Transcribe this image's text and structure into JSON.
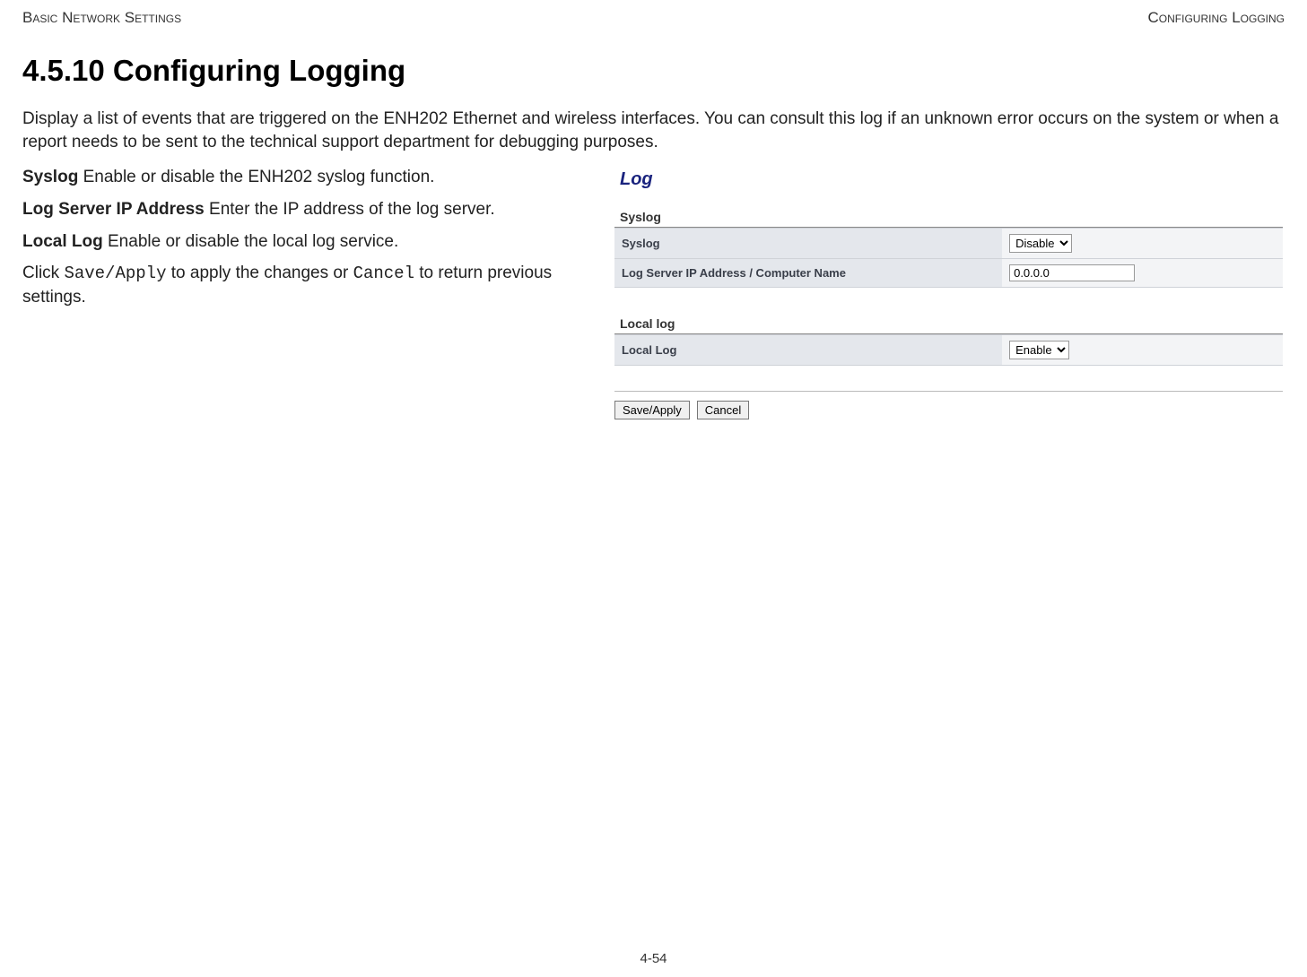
{
  "header": {
    "left": "Basic Network Settings",
    "right": "Configuring Logging"
  },
  "section": {
    "heading": "4.5.10 Configuring Logging",
    "intro": "Display a list of events that are triggered on the ENH202 Ethernet and wireless interfaces. You can consult this log if an unknown error occurs on the system or when a report needs to be sent to the technical support department for debugging purposes."
  },
  "definitions": {
    "syslog_term": "Syslog",
    "syslog_desc": "  Enable or disable the ENH202 syslog function.",
    "logserver_term": "Log Server IP Address",
    "logserver_desc": "  Enter the IP address of the log server.",
    "locallog_term": "Local Log",
    "locallog_desc": "  Enable or disable the local log service.",
    "click_prefix": "Click ",
    "save_apply_code": "Save/Apply",
    "click_mid": " to apply the changes or ",
    "cancel_code": "Cancel",
    "click_suffix": " to return previous settings."
  },
  "ui": {
    "title": "Log",
    "syslog_section": "Syslog",
    "syslog_row_label": "Syslog",
    "syslog_select_value": "Disable",
    "logserver_row_label": "Log Server IP Address / Computer Name",
    "logserver_input_value": "0.0.0.0",
    "locallog_section": "Local log",
    "locallog_row_label": "Local Log",
    "locallog_select_value": "Enable",
    "save_button": "Save/Apply",
    "cancel_button": "Cancel"
  },
  "footer": {
    "page_number": "4-54"
  }
}
